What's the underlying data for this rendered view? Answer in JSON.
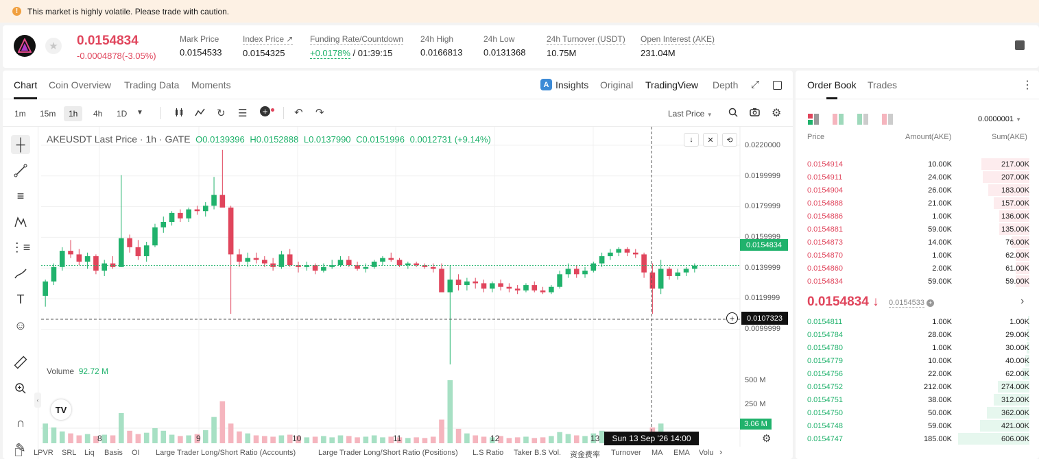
{
  "banner": {
    "text": "This market is highly volatile. Please trade with caution."
  },
  "ticker": {
    "last_price": "0.0154834",
    "change": "-0.0004878(-3.05%)",
    "stats": [
      {
        "label": "Mark Price",
        "value": "0.0154533"
      },
      {
        "label": "Index Price ↗",
        "value": "0.0154325"
      },
      {
        "label": "Funding Rate/Countdown",
        "rate": "+0.0178%",
        "countdown": "/ 01:39:15"
      },
      {
        "label": "24h High",
        "value": "0.0166813"
      },
      {
        "label": "24h Low",
        "value": "0.0131368"
      },
      {
        "label": "24h Turnover (USDT)",
        "value": "10.75M"
      },
      {
        "label": "Open Interest (AKE)",
        "value": "231.04M"
      }
    ]
  },
  "chart_tabs": [
    "Chart",
    "Coin Overview",
    "Trading Data",
    "Moments"
  ],
  "view_tabs": [
    "Insights",
    "Original",
    "TradingView",
    "Depth"
  ],
  "timeframes": [
    "1m",
    "15m",
    "1h",
    "4h",
    "1D"
  ],
  "price_source": "Last Price",
  "legend": {
    "pair": "AKEUSDT Last Price · 1h · GATE",
    "o": "O0.0139396",
    "h": "H0.0152888",
    "l": "L0.0137990",
    "c": "C0.0151996",
    "change": "0.0012731 (+9.14%)"
  },
  "volume_label": "Volume",
  "volume_value": "92.72 M",
  "y_axis": [
    "0.0220000",
    "0.0199999",
    "0.0179999",
    "0.0159999",
    "0.0139999",
    "0.0119999",
    "0.0099999"
  ],
  "vol_axis": [
    "500 M",
    "250 M"
  ],
  "tags": {
    "price": "0.0154834",
    "cross": "0.0107323",
    "volume": "3.06 M"
  },
  "x_axis": [
    "8",
    "9",
    "10",
    "11",
    "12",
    "13"
  ],
  "crosshair_time": "Sun 13 Sep '26   14:00",
  "indicators": [
    "LPVR",
    "SRL",
    "Liq",
    "Basis",
    "OI",
    "Large Trader Long/Short Ratio (Accounts)",
    "Large Trader Long/Short Ratio (Positions)",
    "L.S Ratio",
    "Taker B.S Vol.",
    "资金费率",
    "Turnover",
    "MA",
    "EMA",
    "Volu"
  ],
  "chart_data": {
    "type": "candlestick",
    "x_labels": [
      "8",
      "9",
      "10",
      "11",
      "12",
      "13"
    ],
    "ylim": [
      0.0095,
      0.0225
    ],
    "candles": [
      [
        0.0138,
        0.0147,
        0.0132,
        0.0146
      ],
      [
        0.0146,
        0.0156,
        0.0144,
        0.0154
      ],
      [
        0.0154,
        0.0165,
        0.0152,
        0.0163
      ],
      [
        0.0163,
        0.0169,
        0.0159,
        0.0161
      ],
      [
        0.0161,
        0.0164,
        0.0155,
        0.0157
      ],
      [
        0.0157,
        0.0162,
        0.0153,
        0.016
      ],
      [
        0.016,
        0.0161,
        0.015,
        0.0152
      ],
      [
        0.0152,
        0.0158,
        0.0149,
        0.0156
      ],
      [
        0.0156,
        0.016,
        0.0153,
        0.0154
      ],
      [
        0.0154,
        0.0205,
        0.0154,
        0.017
      ],
      [
        0.017,
        0.0172,
        0.0162,
        0.0165
      ],
      [
        0.0165,
        0.0169,
        0.0158,
        0.016
      ],
      [
        0.016,
        0.0168,
        0.0157,
        0.0166
      ],
      [
        0.0166,
        0.0178,
        0.0165,
        0.0176
      ],
      [
        0.0176,
        0.0182,
        0.0173,
        0.0179
      ],
      [
        0.0179,
        0.0185,
        0.0177,
        0.0184
      ],
      [
        0.0184,
        0.0186,
        0.0179,
        0.0181
      ],
      [
        0.0181,
        0.0187,
        0.0179,
        0.0186
      ],
      [
        0.0186,
        0.0188,
        0.0183,
        0.0185
      ],
      [
        0.0185,
        0.019,
        0.0182,
        0.0188
      ],
      [
        0.0188,
        0.0204,
        0.0186,
        0.0194
      ],
      [
        0.0194,
        0.0219,
        0.0192,
        0.0187
      ],
      [
        0.0187,
        0.0188,
        0.0128,
        0.0161
      ],
      [
        0.0161,
        0.0164,
        0.0154,
        0.0157
      ],
      [
        0.0157,
        0.0162,
        0.0154,
        0.0159
      ],
      [
        0.0159,
        0.0162,
        0.0156,
        0.0158
      ],
      [
        0.0158,
        0.016,
        0.0154,
        0.0156
      ],
      [
        0.0156,
        0.0159,
        0.0152,
        0.0154
      ],
      [
        0.0154,
        0.0163,
        0.0153,
        0.0161
      ],
      [
        0.0161,
        0.0164,
        0.0154,
        0.0155
      ],
      [
        0.0155,
        0.0157,
        0.0151,
        0.0154
      ],
      [
        0.0154,
        0.0157,
        0.0152,
        0.0155
      ],
      [
        0.0155,
        0.0156,
        0.015,
        0.0152
      ],
      [
        0.0152,
        0.0156,
        0.0151,
        0.0154
      ],
      [
        0.0154,
        0.0158,
        0.0153,
        0.0155
      ],
      [
        0.0155,
        0.016,
        0.0154,
        0.0158
      ],
      [
        0.0158,
        0.016,
        0.0154,
        0.0155
      ],
      [
        0.0155,
        0.0157,
        0.0152,
        0.0153
      ],
      [
        0.0153,
        0.0156,
        0.0151,
        0.0154
      ],
      [
        0.0154,
        0.0158,
        0.0153,
        0.0157
      ],
      [
        0.0157,
        0.016,
        0.0155,
        0.0159
      ],
      [
        0.0159,
        0.0162,
        0.0157,
        0.0158
      ],
      [
        0.0158,
        0.0159,
        0.0154,
        0.0155
      ],
      [
        0.0155,
        0.0157,
        0.0153,
        0.0156
      ],
      [
        0.0156,
        0.0157,
        0.0154,
        0.0155
      ],
      [
        0.0155,
        0.0156,
        0.0153,
        0.0154
      ],
      [
        0.0154,
        0.0156,
        0.0151,
        0.0153
      ],
      [
        0.0153,
        0.0156,
        0.0145,
        0.014
      ],
      [
        0.014,
        0.0155,
        0.01,
        0.0147
      ],
      [
        0.0147,
        0.015,
        0.0141,
        0.0144
      ],
      [
        0.0144,
        0.0148,
        0.0141,
        0.0146
      ],
      [
        0.0146,
        0.0148,
        0.0142,
        0.0145
      ],
      [
        0.0145,
        0.0147,
        0.014,
        0.0142
      ],
      [
        0.0142,
        0.0146,
        0.014,
        0.0145
      ],
      [
        0.0145,
        0.0147,
        0.0141,
        0.0143
      ],
      [
        0.0143,
        0.0145,
        0.014,
        0.0142
      ],
      [
        0.0142,
        0.0144,
        0.0139,
        0.0141
      ],
      [
        0.0141,
        0.0145,
        0.014,
        0.0144
      ],
      [
        0.0144,
        0.0146,
        0.014,
        0.0141
      ],
      [
        0.0141,
        0.0143,
        0.0139,
        0.014
      ],
      [
        0.014,
        0.0144,
        0.0139,
        0.0143
      ],
      [
        0.0143,
        0.0152,
        0.0142,
        0.015
      ],
      [
        0.015,
        0.0156,
        0.0148,
        0.0153
      ],
      [
        0.0153,
        0.0155,
        0.0148,
        0.015
      ],
      [
        0.015,
        0.0154,
        0.0148,
        0.0152
      ],
      [
        0.0152,
        0.0157,
        0.0151,
        0.0156
      ],
      [
        0.0156,
        0.0162,
        0.0154,
        0.016
      ],
      [
        0.016,
        0.0164,
        0.0158,
        0.0162
      ],
      [
        0.0162,
        0.0165,
        0.016,
        0.0164
      ],
      [
        0.0164,
        0.0165,
        0.016,
        0.0162
      ],
      [
        0.0162,
        0.0164,
        0.0159,
        0.0161
      ],
      [
        0.0161,
        0.0162,
        0.0148,
        0.0151
      ],
      [
        0.0151,
        0.0156,
        0.0128,
        0.0142
      ],
      [
        0.0142,
        0.0158,
        0.0139,
        0.0153
      ],
      [
        0.0153,
        0.0154,
        0.0147,
        0.0149
      ],
      [
        0.0149,
        0.0153,
        0.0147,
        0.0151
      ],
      [
        0.0151,
        0.0154,
        0.0149,
        0.0153
      ],
      [
        0.0153,
        0.0156,
        0.0151,
        0.01548
      ]
    ],
    "volume": [
      150,
      120,
      90,
      75,
      60,
      70,
      55,
      65,
      60,
      230,
      95,
      70,
      80,
      115,
      95,
      65,
      55,
      60,
      70,
      100,
      200,
      320,
      150,
      90,
      75,
      60,
      55,
      50,
      60,
      65,
      55,
      45,
      50,
      55,
      45,
      60,
      55,
      45,
      50,
      60,
      45,
      50,
      45,
      40,
      45,
      40,
      50,
      180,
      480,
      110,
      75,
      60,
      50,
      45,
      55,
      40,
      45,
      50,
      40,
      45,
      55,
      85,
      70,
      60,
      55,
      75,
      95,
      55,
      50,
      65,
      60,
      70,
      120,
      150,
      80,
      55,
      45,
      60
    ]
  },
  "orderbook": {
    "tabs": [
      "Order Book",
      "Trades"
    ],
    "precision": "0.0000001",
    "headers": [
      "Price",
      "Amount(AKE)",
      "Sum(AKE)"
    ],
    "asks": [
      {
        "price": "0.0154914",
        "amount": "10.00K",
        "sum": "217.00K",
        "depth": 0.35
      },
      {
        "price": "0.0154911",
        "amount": "24.00K",
        "sum": "207.00K",
        "depth": 0.34
      },
      {
        "price": "0.0154904",
        "amount": "26.00K",
        "sum": "183.00K",
        "depth": 0.3
      },
      {
        "price": "0.0154888",
        "amount": "21.00K",
        "sum": "157.00K",
        "depth": 0.26
      },
      {
        "price": "0.0154886",
        "amount": "1.00K",
        "sum": "136.00K",
        "depth": 0.22
      },
      {
        "price": "0.0154881",
        "amount": "59.00K",
        "sum": "135.00K",
        "depth": 0.22
      },
      {
        "price": "0.0154873",
        "amount": "14.00K",
        "sum": "76.00K",
        "depth": 0.13
      },
      {
        "price": "0.0154870",
        "amount": "1.00K",
        "sum": "62.00K",
        "depth": 0.1
      },
      {
        "price": "0.0154860",
        "amount": "2.00K",
        "sum": "61.00K",
        "depth": 0.1
      },
      {
        "price": "0.0154834",
        "amount": "59.00K",
        "sum": "59.00K",
        "depth": 0.1
      }
    ],
    "mid_price": "0.0154834 ↓",
    "mark_price": "0.0154533",
    "bids": [
      {
        "price": "0.0154811",
        "amount": "1.00K",
        "sum": "1.00K",
        "depth": 0.01
      },
      {
        "price": "0.0154784",
        "amount": "28.00K",
        "sum": "29.00K",
        "depth": 0.02
      },
      {
        "price": "0.0154780",
        "amount": "1.00K",
        "sum": "30.00K",
        "depth": 0.02
      },
      {
        "price": "0.0154779",
        "amount": "10.00K",
        "sum": "40.00K",
        "depth": 0.03
      },
      {
        "price": "0.0154756",
        "amount": "22.00K",
        "sum": "62.00K",
        "depth": 0.05
      },
      {
        "price": "0.0154752",
        "amount": "212.00K",
        "sum": "274.00K",
        "depth": 0.23
      },
      {
        "price": "0.0154751",
        "amount": "38.00K",
        "sum": "312.00K",
        "depth": 0.26
      },
      {
        "price": "0.0154750",
        "amount": "50.00K",
        "sum": "362.00K",
        "depth": 0.31
      },
      {
        "price": "0.0154748",
        "amount": "59.00K",
        "sum": "421.00K",
        "depth": 0.36
      },
      {
        "price": "0.0154747",
        "amount": "185.00K",
        "sum": "606.00K",
        "depth": 0.52
      }
    ]
  }
}
